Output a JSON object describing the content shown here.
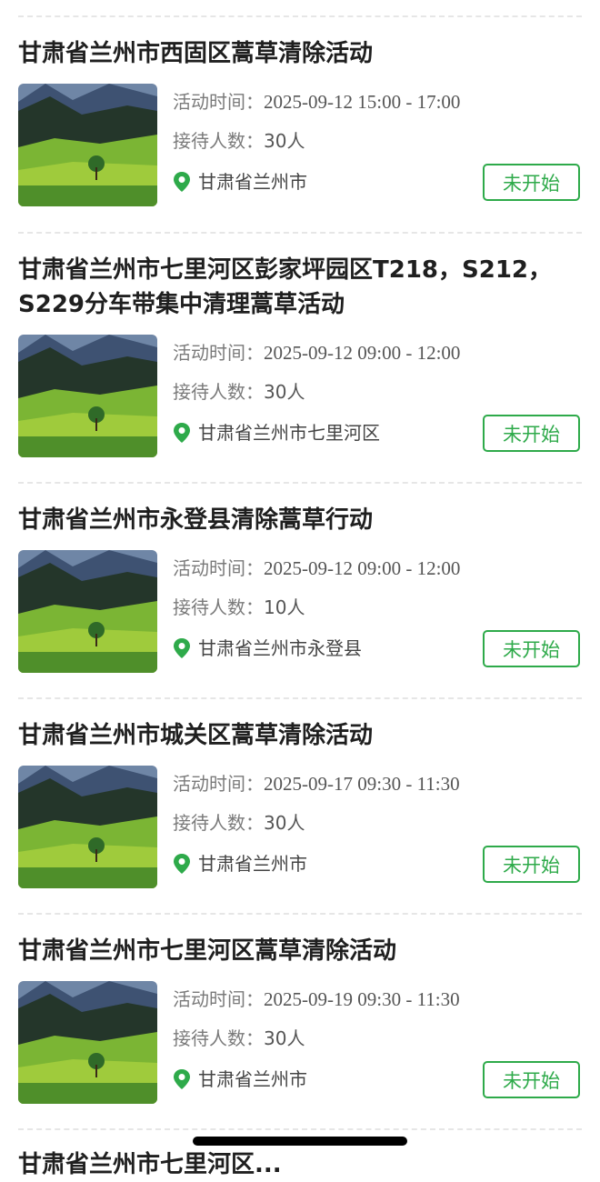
{
  "activities": [
    {
      "title": "甘肃省兰州市西固区蒿草清除活动",
      "time_label": "活动时间：",
      "time_value": "2025-09-12 15:00 - 17:00",
      "people_label": "接待人数：",
      "people_value": "30人",
      "location": "甘肃省兰州市",
      "status": "未开始"
    },
    {
      "title": "甘肃省兰州市七里河区彭家坪园区T218，S212，S229分车带集中清理蒿草活动",
      "time_label": "活动时间：",
      "time_value": "2025-09-12 09:00 - 12:00",
      "people_label": "接待人数：",
      "people_value": "30人",
      "location": "甘肃省兰州市七里河区",
      "status": "未开始"
    },
    {
      "title": "甘肃省兰州市永登县清除蒿草行动",
      "time_label": "活动时间：",
      "time_value": "2025-09-12 09:00 - 12:00",
      "people_label": "接待人数：",
      "people_value": "10人",
      "location": "甘肃省兰州市永登县",
      "status": "未开始"
    },
    {
      "title": "甘肃省兰州市城关区蒿草清除活动",
      "time_label": "活动时间：",
      "time_value": "2025-09-17 09:30 - 11:30",
      "people_label": "接待人数：",
      "people_value": "30人",
      "location": "甘肃省兰州市",
      "status": "未开始"
    },
    {
      "title": "甘肃省兰州市七里河区蒿草清除活动",
      "time_label": "活动时间：",
      "time_value": "2025-09-19 09:30 - 11:30",
      "people_label": "接待人数：",
      "people_value": "30人",
      "location": "甘肃省兰州市",
      "status": "未开始"
    }
  ],
  "partial_next_title": "甘肃省兰州市七里河区...",
  "icons": {
    "location": "location-pin-icon",
    "thumbnail": "landscape-thumbnail"
  },
  "colors": {
    "accent": "#2eaa4a",
    "title": "#1f1f1f",
    "label": "#7a7a7a",
    "divider": "#e6e6e6"
  }
}
